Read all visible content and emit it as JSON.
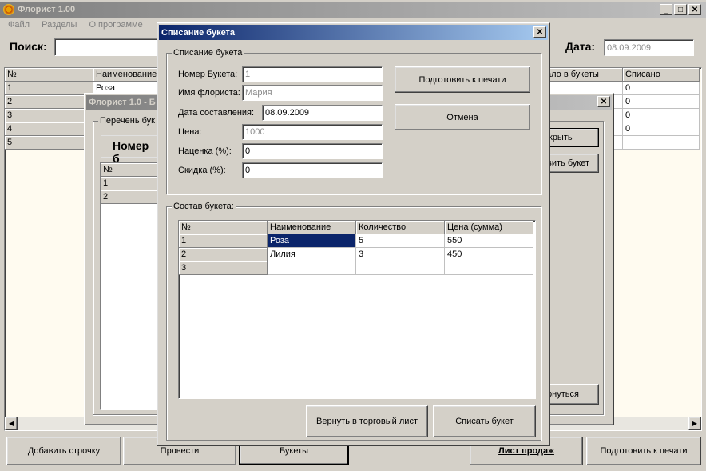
{
  "main": {
    "title": "Флорист 1.00",
    "menu": [
      "Файл",
      "Разделы",
      "О программе"
    ],
    "search_label": "Поиск:",
    "date_label": "Дата:",
    "date_value": "08.09.2009",
    "grid_headers": [
      "№",
      "Наименование",
      "ало в букеты",
      "Списано"
    ],
    "grid_rows": [
      {
        "num": "1",
        "name": "Роза",
        "spis": "0"
      },
      {
        "num": "2",
        "name": "",
        "spis": "0"
      },
      {
        "num": "3",
        "name": "",
        "spis": "0"
      },
      {
        "num": "4",
        "name": "",
        "spis": "0"
      },
      {
        "num": "5",
        "name": "",
        "spis": ""
      }
    ],
    "bottom_buttons": {
      "add_row": "Добавить строчку",
      "post": "Провести",
      "bouquets": "Букеты",
      "sales_list": "Лист продаж",
      "print": "Подготовить к печати"
    }
  },
  "middle": {
    "title": "Флорист 1.0 - Б",
    "group_label": "Перечень бук",
    "number_label": "Номер б",
    "grid_header": "№",
    "rows": [
      "1",
      "2"
    ],
    "btn_open": "крыть",
    "btn_bouquet": "вить букет",
    "btn_return": "рнуться"
  },
  "dialog": {
    "title": "Списание букета",
    "group1_label": "Списание букета",
    "fields": {
      "number_label": "Номер Букета:",
      "number_value": "1",
      "florist_label": "Имя флориста:",
      "florist_value": "Мария",
      "date_label": "Дата составления:",
      "date_value": "08.09.2009",
      "price_label": "Цена:",
      "price_value": "1000",
      "markup_label": "Наценка (%):",
      "markup_value": "0",
      "discount_label": "Скидка (%):",
      "discount_value": "0"
    },
    "btn_print": "Подготовить к печати",
    "btn_cancel": "Отмена",
    "group2_label": "Состав букета:",
    "table_headers": [
      "№",
      "Наименование",
      "Количество",
      "Цена (сумма)"
    ],
    "table_rows": [
      {
        "num": "1",
        "name": "Роза",
        "qty": "5",
        "price": "550"
      },
      {
        "num": "2",
        "name": "Лилия",
        "qty": "3",
        "price": "450"
      },
      {
        "num": "3",
        "name": "",
        "qty": "",
        "price": ""
      }
    ],
    "btn_return": "Вернуть в торговый лист",
    "btn_writeoff": "Списать букет"
  }
}
